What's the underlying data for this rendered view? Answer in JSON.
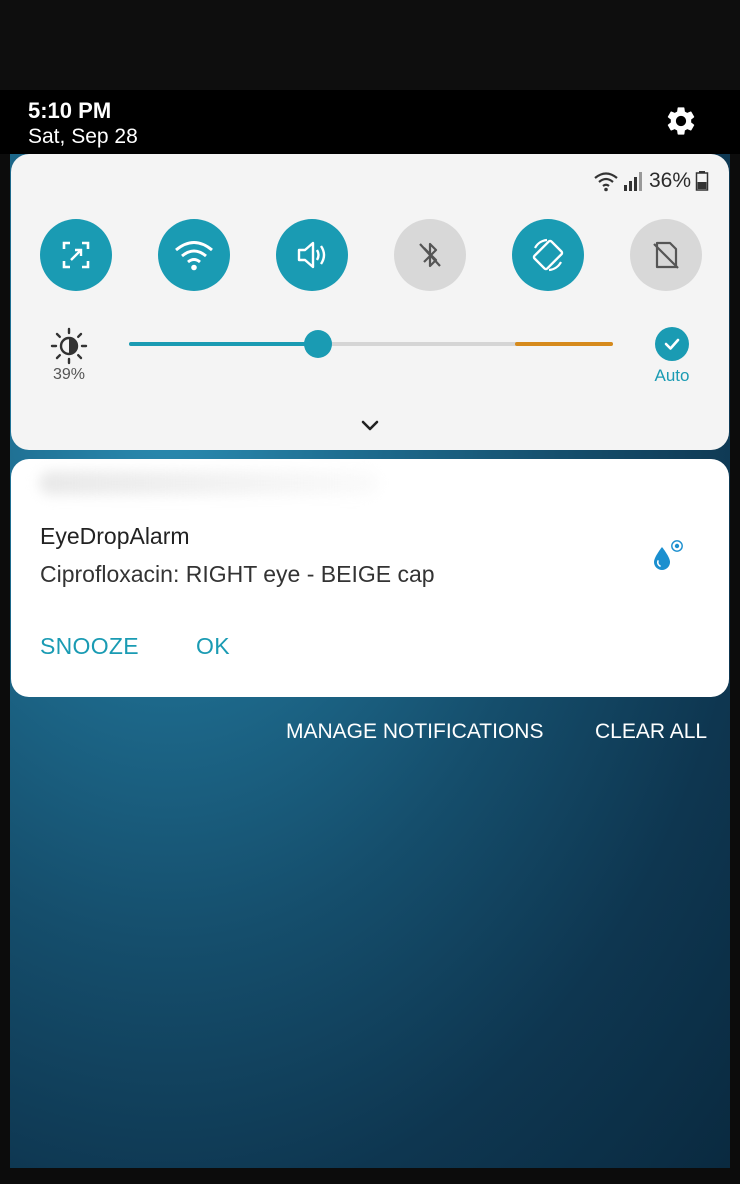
{
  "header": {
    "time": "5:10 PM",
    "date": "Sat, Sep 28",
    "settings_icon": "gear-icon"
  },
  "status_bar": {
    "wifi_icon": "wifi-icon",
    "signal_icon": "signal-icon",
    "battery_percent": "36%",
    "battery_icon": "battery-icon"
  },
  "quick_settings": {
    "tiles": [
      {
        "icon": "screen-capture-icon",
        "state": "on"
      },
      {
        "icon": "wifi-icon",
        "state": "on"
      },
      {
        "icon": "sound-icon",
        "state": "on"
      },
      {
        "icon": "bluetooth-off-icon",
        "state": "off"
      },
      {
        "icon": "auto-rotate-icon",
        "state": "on"
      },
      {
        "icon": "no-sim-icon",
        "state": "off"
      }
    ],
    "accent_color": "#1a9bb3",
    "brightness": {
      "value_label": "39%",
      "level": 0.39,
      "auto_label": "Auto",
      "auto_enabled": true
    }
  },
  "notification": {
    "app_name": "EyeDropAlarm",
    "text": "Ciprofloxacin: RIGHT eye - BEIGE cap",
    "app_icon": "eye-drop-icon",
    "actions": [
      "SNOOZE",
      "OK"
    ]
  },
  "footer": {
    "manage_label": "MANAGE NOTIFICATIONS",
    "clear_label": "CLEAR ALL"
  }
}
